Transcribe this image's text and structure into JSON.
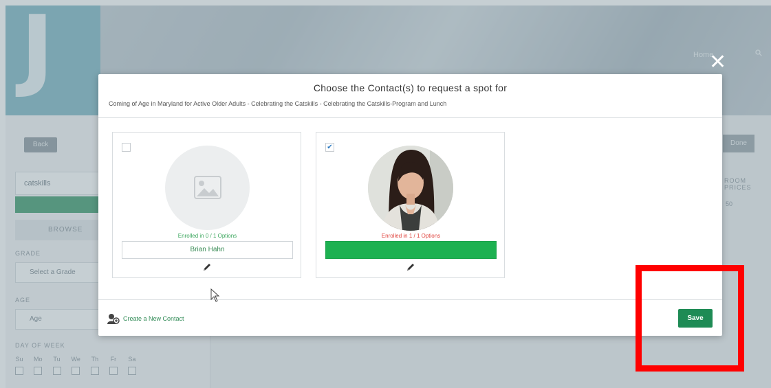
{
  "background": {
    "logo_letter": "J",
    "nav": {
      "home": "Home"
    },
    "back_label": "Back",
    "search_value": "catskills",
    "browse_label": "BROWSE",
    "grade": {
      "label": "GRADE",
      "placeholder": "Select a Grade"
    },
    "age": {
      "label": "AGE",
      "placeholder": "Age"
    },
    "day_of_week": {
      "label": "DAY OF WEEK",
      "days": [
        "Su",
        "Mo",
        "Tu",
        "We",
        "Th",
        "Fr",
        "Sa"
      ]
    },
    "right_button": "Done",
    "right_label": "ROOM PRICES",
    "right_value": "50"
  },
  "modal": {
    "title": "Choose the Contact(s) to request a spot for",
    "subtitle": "Coming of Age in Maryland for Active Older Adults - Celebrating the Catskills - Celebrating the Catskills-Program and Lunch",
    "close_glyph": "✕",
    "contacts": [
      {
        "name": "Brian Hahn",
        "enrollment": "Enrolled in 0 / 1 Options",
        "checked": false,
        "check_glyph": ""
      },
      {
        "name": "",
        "enrollment": "Enrolled in 1 / 1 Options",
        "checked": true,
        "check_glyph": "✔"
      }
    ],
    "footer": {
      "create_contact_label": "Create a New Contact",
      "save_label": "Save"
    }
  },
  "colors": {
    "accent_green": "#1e8b55",
    "enrolled_ok": "#3aa65c",
    "enrolled_full": "#e0443e",
    "selected_bar": "#1db151",
    "highlight_box": "#ff0000"
  }
}
